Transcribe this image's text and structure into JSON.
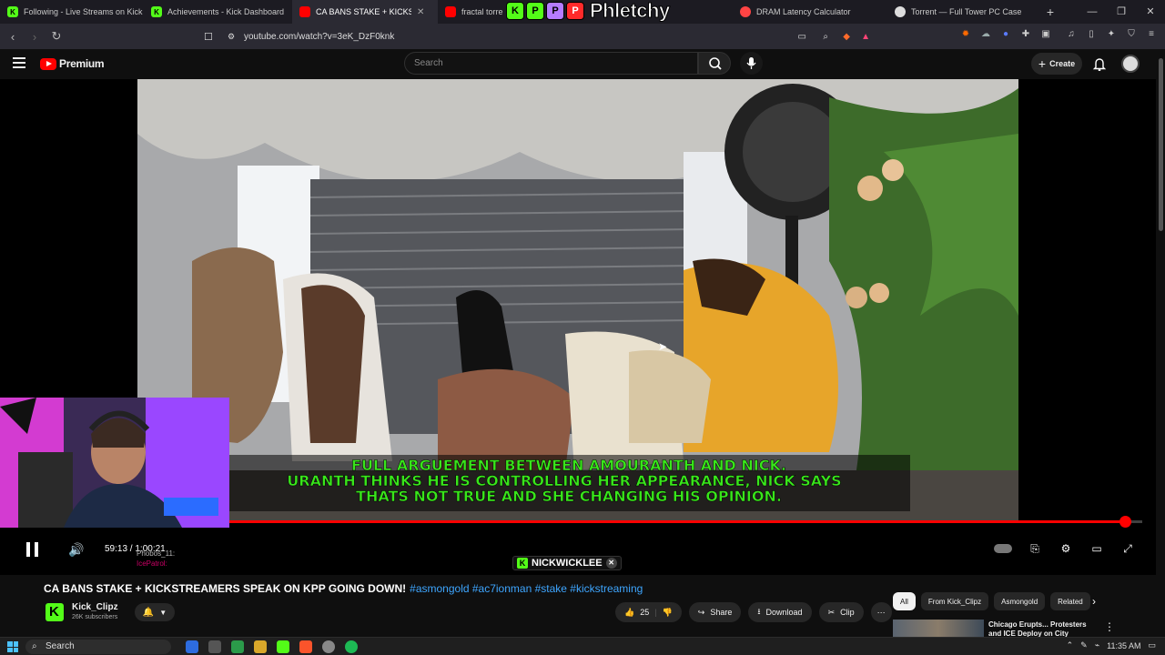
{
  "browser": {
    "tabs": [
      {
        "label": "Following - Live Streams on Kick",
        "favicon": "kick-icon",
        "color": "#53fc18"
      },
      {
        "label": "Achievements - Kick Dashboard",
        "favicon": "kick-icon",
        "color": "#53fc18"
      },
      {
        "label": "CA BANS STAKE + KICKSTREAMERS",
        "favicon": "youtube-icon",
        "color": "#ff0000",
        "active": true
      },
      {
        "label": "fractal torre",
        "favicon": "youtube-icon",
        "color": "#ff0000"
      },
      {
        "label": "DRAM Latency Calculator",
        "favicon": "site-icon",
        "color": "#ff4444"
      },
      {
        "label": "Torrent — Full Tower PC Case",
        "favicon": "site-icon",
        "color": "#dddddd"
      }
    ],
    "url": "youtube.com/watch?v=3eK_DzF0knk"
  },
  "overlay_logo": {
    "letters": [
      "K",
      "P",
      "P",
      "P"
    ],
    "name": "Phletchy"
  },
  "youtube": {
    "logo_label": "Premium",
    "search_placeholder": "Search",
    "create_label": "Create"
  },
  "video": {
    "subtitle_lines": [
      "FULL ARGUEMENT BETWEEN AMOURANTH AND NICK.",
      "URANTH THINKS HE IS CONTROLLING HER APPEARANCE, NICK SAYS",
      "THATS NOT TRUE AND SHE CHANGING HIS OPINION."
    ],
    "time": "59:13 / 1:00:21",
    "progress_fraction": 0.981,
    "chat": [
      {
        "user": "Phobos_11:"
      },
      {
        "user": "IcePatrol:"
      }
    ],
    "watermark": "NICKWICKLEE"
  },
  "meta": {
    "title": "CA BANS STAKE + KICKSTREAMERS SPEAK ON KPP GOING DOWN!",
    "tags": "#asmongold #ac7ionman #stake #kickstreaming",
    "channel_name": "Kick_Clipz",
    "subscribers": "26K subscribers",
    "likes": "25",
    "share_label": "Share",
    "download_label": "Download",
    "clip_label": "Clip"
  },
  "filters": [
    "All",
    "From Kick_Clipz",
    "Asmongold",
    "Related"
  ],
  "recommendation": {
    "title": "Chicago Erupts... Protesters and ICE Deploy on City"
  },
  "taskbar": {
    "search_label": "Search",
    "time": "11:35 AM"
  }
}
